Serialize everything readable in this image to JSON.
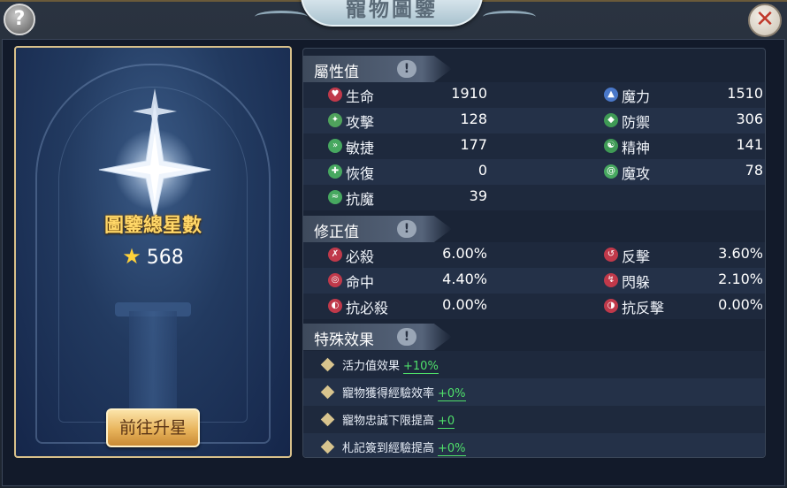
{
  "window": {
    "title": "寵物圖鑒"
  },
  "help_glyph": "?",
  "close_glyph": "✕",
  "card": {
    "total_label": "圖鑒總星數",
    "total_value": "568",
    "star_glyph": "★",
    "upgrade_button": "前往升星"
  },
  "attributes": {
    "title": "屬性值",
    "info_glyph": "!",
    "items": [
      {
        "label": "生命",
        "value": "1910",
        "icon": "heart-icon",
        "color": "#c0394a"
      },
      {
        "label": "魔力",
        "value": "1510",
        "icon": "potion-icon",
        "color": "#4a78c9"
      },
      {
        "label": "攻擊",
        "value": "128",
        "icon": "claw-icon",
        "color": "#4fa35c"
      },
      {
        "label": "防禦",
        "value": "306",
        "icon": "shield-icon",
        "color": "#3f9a55"
      },
      {
        "label": "敏捷",
        "value": "177",
        "icon": "run-icon",
        "color": "#47a860"
      },
      {
        "label": "精神",
        "value": "141",
        "icon": "spirit-icon",
        "color": "#3f9a55"
      },
      {
        "label": "恢復",
        "value": "0",
        "icon": "recover-icon",
        "color": "#47a860"
      },
      {
        "label": "魔攻",
        "value": "78",
        "icon": "swirl-icon",
        "color": "#47a860"
      },
      {
        "label": "抗魔",
        "value": "39",
        "icon": "resist-icon",
        "color": "#47a860"
      }
    ]
  },
  "modifiers": {
    "title": "修正值",
    "info_glyph": "!",
    "items": [
      {
        "label": "必殺",
        "value": "6.00%",
        "icon": "crit-icon",
        "color": "#c0394a"
      },
      {
        "label": "反擊",
        "value": "3.60%",
        "icon": "counter-icon",
        "color": "#c0394a"
      },
      {
        "label": "命中",
        "value": "4.40%",
        "icon": "hit-icon",
        "color": "#c0394a"
      },
      {
        "label": "閃躲",
        "value": "2.10%",
        "icon": "dodge-icon",
        "color": "#c0394a"
      },
      {
        "label": "抗必殺",
        "value": "0.00%",
        "icon": "anti-crit-icon",
        "color": "#c0394a"
      },
      {
        "label": "抗反擊",
        "value": "0.00%",
        "icon": "anti-counter-icon",
        "color": "#c0394a"
      }
    ]
  },
  "special": {
    "title": "特殊效果",
    "info_glyph": "!",
    "items": [
      {
        "label": "活力值效果",
        "bonus": "+10%"
      },
      {
        "label": "寵物獲得經驗效率",
        "bonus": "+0%"
      },
      {
        "label": "寵物忠誠下限提高",
        "bonus": "+0"
      },
      {
        "label": "札記簽到經驗提高",
        "bonus": "+0%"
      }
    ]
  }
}
